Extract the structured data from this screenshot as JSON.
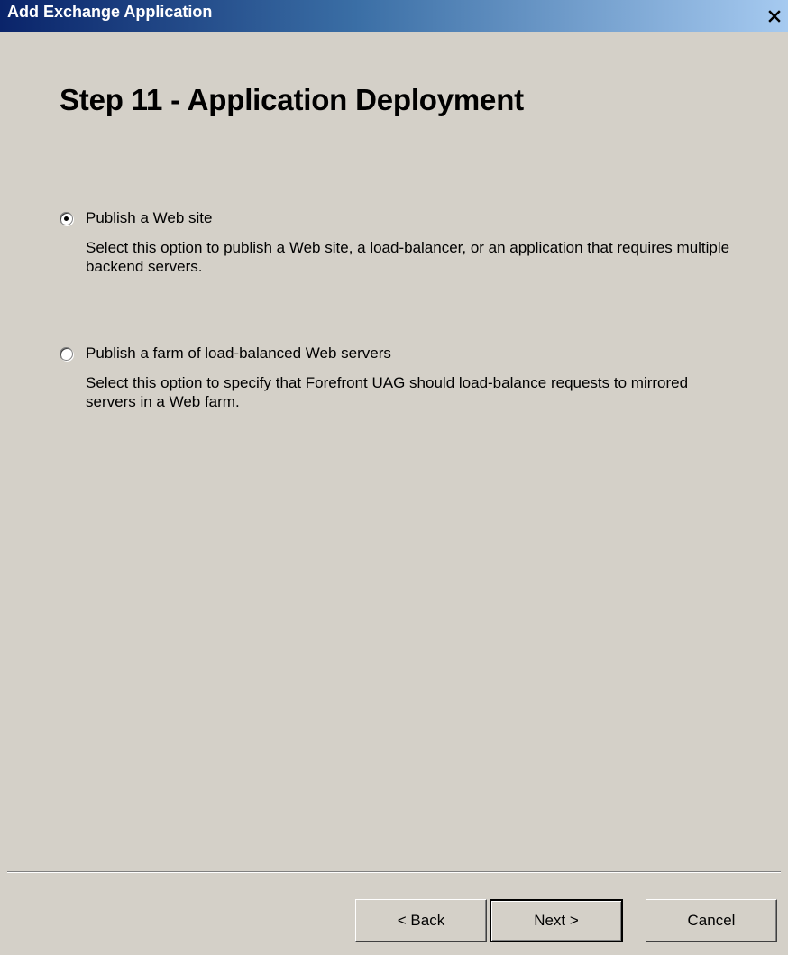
{
  "window": {
    "title": "Add Exchange Application",
    "close_glyph": "✕"
  },
  "wizard": {
    "heading": "Step 11 - Application Deployment",
    "options": [
      {
        "label": "Publish a Web site",
        "description": "Select this option to publish a Web site, a load-balancer, or an application that requires multiple backend servers.",
        "selected": true
      },
      {
        "label": "Publish a farm of load-balanced Web servers",
        "description": "Select this option to specify that Forefront UAG should load-balance requests to mirrored servers in a Web farm.",
        "selected": false
      }
    ]
  },
  "buttons": {
    "back": "< Back",
    "next": "Next >",
    "cancel": "Cancel"
  },
  "icons": {
    "close": "close-icon",
    "radio_selected": "radio-selected-icon",
    "radio_unselected": "radio-unselected-icon"
  },
  "colors": {
    "titlebar_start": "#0a246a",
    "titlebar_end": "#a6caf0",
    "dialog_background": "#d4d0c8"
  }
}
